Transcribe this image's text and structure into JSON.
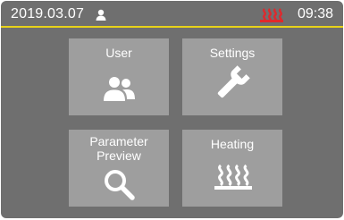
{
  "status": {
    "date": "2019.03.07",
    "time": "09:38",
    "icons": {
      "user": "user-icon",
      "heating": "heating-icon"
    },
    "colors": {
      "divider": "#e8d21a",
      "heating_active": "#e0282c"
    }
  },
  "menu": {
    "user": {
      "label": "User",
      "icon": "users-icon"
    },
    "settings": {
      "label": "Settings",
      "icon": "wrench-icon"
    },
    "parameter_preview": {
      "label_line1": "Parameter",
      "label_line2": "Preview",
      "icon": "search-icon"
    },
    "heating": {
      "label": "Heating",
      "icon": "heating-icon"
    }
  },
  "colors": {
    "background": "#6f6f6f",
    "tile": "#9e9e9e",
    "text": "#ffffff"
  }
}
